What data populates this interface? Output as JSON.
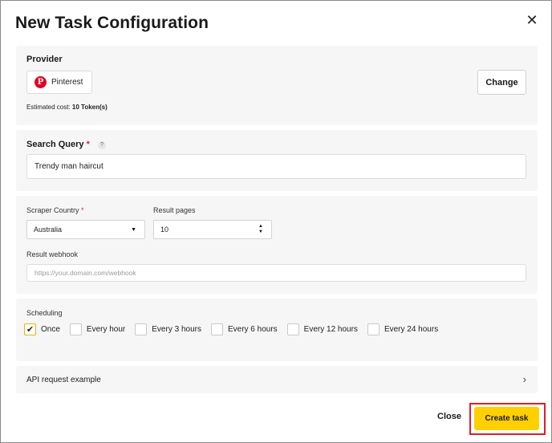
{
  "dialog": {
    "title": "New Task Configuration",
    "close_icon": "close-icon"
  },
  "provider": {
    "label": "Provider",
    "name": "Pinterest",
    "icon": "pinterest-icon",
    "icon_glyph": "P",
    "brand_color": "#e60023",
    "change_label": "Change",
    "cost_prefix": "Estimated cost: ",
    "cost_value": "10 Token(s)"
  },
  "search": {
    "label": "Search Query",
    "required_mark": "*",
    "help_glyph": "?",
    "value": "Trendy man haircut"
  },
  "settings": {
    "country_label": "Scraper Country",
    "country_required": "*",
    "country_value": "Australia",
    "pages_label": "Result pages",
    "pages_value": "10",
    "webhook_label": "Result webhook",
    "webhook_placeholder": "https://your.domain.com/webhook"
  },
  "scheduling": {
    "label": "Scheduling",
    "options": [
      {
        "label": "Once",
        "checked": true
      },
      {
        "label": "Every hour",
        "checked": false
      },
      {
        "label": "Every 3 hours",
        "checked": false
      },
      {
        "label": "Every 6 hours",
        "checked": false
      },
      {
        "label": "Every 12 hours",
        "checked": false
      },
      {
        "label": "Every 24 hours",
        "checked": false
      }
    ]
  },
  "api": {
    "label": "API request example",
    "chevron_icon": "chevron-right-icon"
  },
  "footer": {
    "close_label": "Close",
    "create_label": "Create task",
    "accent": "#ffd000",
    "highlight": "#e51c23"
  }
}
